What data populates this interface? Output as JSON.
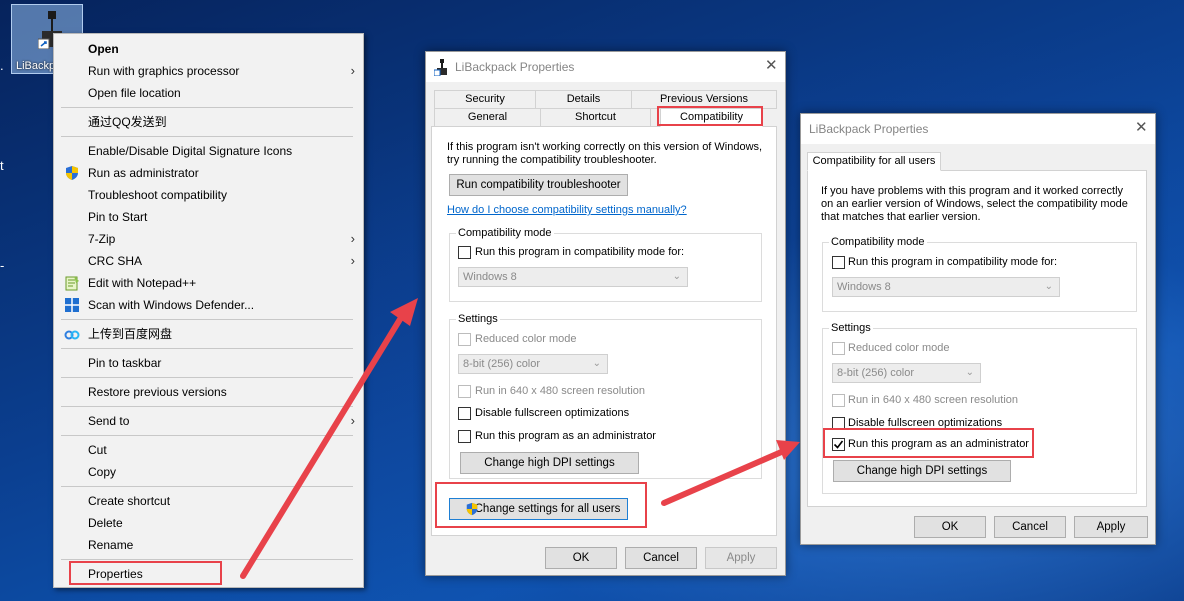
{
  "desktop": {
    "icon_label": "LiBackp",
    "edge_glyph_1": ".",
    "edge_glyph_2": "t",
    "edge_glyph_3": "-"
  },
  "context_menu": {
    "items": [
      {
        "label": "Open",
        "bold": true
      },
      {
        "label": "Run with graphics processor",
        "submenu": true
      },
      {
        "label": "Open file location"
      },
      {
        "label": "通过QQ发送到"
      },
      {
        "label": "Enable/Disable Digital Signature Icons"
      },
      {
        "label": "Run as administrator",
        "icon": "uac-shield-icon"
      },
      {
        "label": "Troubleshoot compatibility"
      },
      {
        "label": "Pin to Start"
      },
      {
        "label": "7-Zip",
        "submenu": true
      },
      {
        "label": "CRC SHA",
        "submenu": true
      },
      {
        "label": "Edit with Notepad++",
        "icon": "notepad-plus-plus-icon"
      },
      {
        "label": "Scan with Windows Defender...",
        "icon": "windows-defender-icon"
      },
      {
        "label": "上传到百度网盘",
        "icon": "baidu-netdisk-icon"
      },
      {
        "label": "Pin to taskbar"
      },
      {
        "label": "Restore previous versions"
      },
      {
        "label": "Send to",
        "submenu": true
      },
      {
        "label": "Cut"
      },
      {
        "label": "Copy"
      },
      {
        "label": "Create shortcut"
      },
      {
        "label": "Delete"
      },
      {
        "label": "Rename"
      },
      {
        "label": "Properties"
      }
    ]
  },
  "properties_dialog": {
    "title": "LiBackpack Properties",
    "tabs_row1": [
      "Security",
      "Details",
      "Previous Versions"
    ],
    "tabs_row2": [
      "General",
      "Shortcut",
      "Compatibility"
    ],
    "active_tab": "Compatibility",
    "intro": [
      "If this program isn't working correctly on this version of Windows,",
      "try running the compatibility troubleshooter."
    ],
    "troubleshooter_button": "Run compatibility troubleshooter",
    "help_link": "How do I choose compatibility settings manually?",
    "compat_mode": {
      "group_title": "Compatibility mode",
      "checkbox_label": "Run this program in compatibility mode for:",
      "checked": false,
      "os_select": "Windows 8"
    },
    "settings": {
      "group_title": "Settings",
      "reduced_color": "Reduced color mode",
      "color_select": "8-bit (256) color",
      "resolution_640": "Run in 640 x 480 screen resolution",
      "disable_fullscreen": "Disable fullscreen optimizations",
      "run_as_admin": "Run this program as an administrator",
      "run_as_admin_checked": false,
      "dpi_button": "Change high DPI settings"
    },
    "all_users_button": "Change settings for all users",
    "ok": "OK",
    "cancel": "Cancel",
    "apply": "Apply"
  },
  "all_users_dialog": {
    "title": "LiBackpack Properties",
    "tab": "Compatibility for all users",
    "intro": [
      "If you have problems with this program and it worked correctly",
      "on an earlier version of Windows, select the compatibility mode",
      "that matches that earlier version."
    ],
    "compat_mode": {
      "group_title": "Compatibility mode",
      "checkbox_label": "Run this program in compatibility mode for:",
      "checked": false,
      "os_select": "Windows 8"
    },
    "settings": {
      "group_title": "Settings",
      "reduced_color": "Reduced color mode",
      "color_select": "8-bit (256) color",
      "resolution_640": "Run in 640 x 480 screen resolution",
      "disable_fullscreen": "Disable fullscreen optimizations",
      "run_as_admin": "Run this program as an administrator",
      "run_as_admin_checked": true,
      "dpi_button": "Change high DPI settings"
    },
    "ok": "OK",
    "cancel": "Cancel",
    "apply": "Apply"
  },
  "colors": {
    "annotation_red": "#e8424a",
    "link_blue": "#0066cc",
    "desktop_blue": "#0a3f8c"
  }
}
